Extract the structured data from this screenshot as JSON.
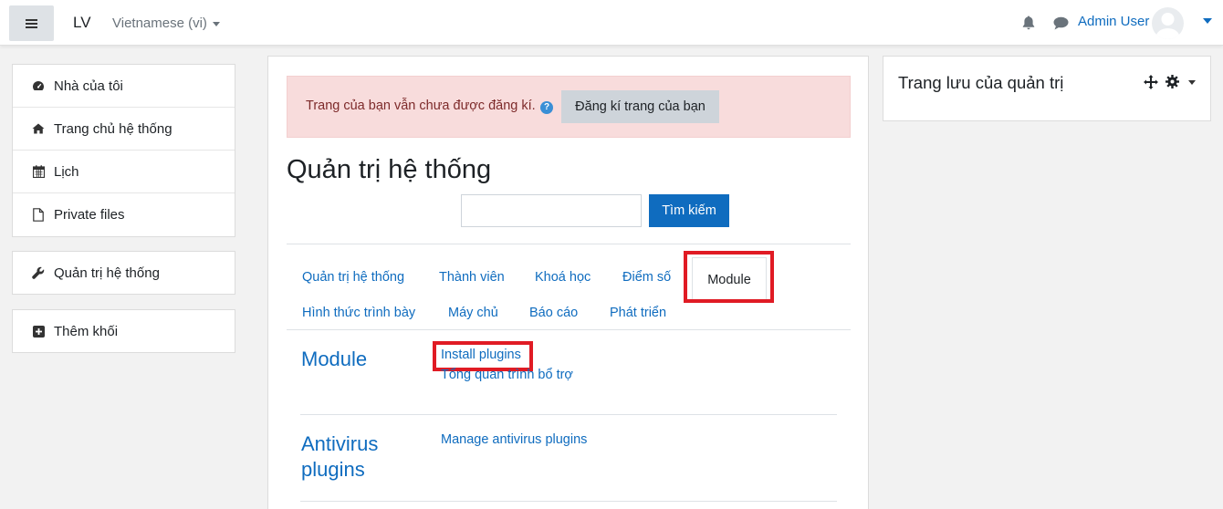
{
  "navbar": {
    "site_name": "LV",
    "language": "Vietnamese (vi)",
    "user_name": "Admin User"
  },
  "leftnav": {
    "items": [
      {
        "label": "Nhà của tôi",
        "icon": "dashboard-icon"
      },
      {
        "label": "Trang chủ hệ thống",
        "icon": "home-icon"
      },
      {
        "label": "Lịch",
        "icon": "calendar-icon"
      },
      {
        "label": "Private files",
        "icon": "file-icon"
      }
    ],
    "admin_label": "Quản trị hệ thống",
    "add_block_label": "Thêm khối"
  },
  "alert": {
    "text": "Trang của bạn vẫn chưa được đăng kí.",
    "help": "?",
    "button_label": "Đăng kí trang của bạn"
  },
  "main": {
    "title": "Quản trị hệ thống",
    "search_button": "Tìm kiếm",
    "search_value": "",
    "tabs_row1": [
      "Quản trị hệ thống",
      "Thành viên",
      "Khoá học",
      "Điểm số",
      "Module"
    ],
    "tabs_row2": [
      "Hình thức trình bày",
      "Máy chủ",
      "Báo cáo",
      "Phát triển"
    ],
    "active_tab": "Module",
    "sections": [
      {
        "title": "Module",
        "links": [
          "Install plugins",
          "Tổng quan trình bổ trợ"
        ]
      },
      {
        "title_lines": [
          "Antivirus",
          "plugins"
        ],
        "links": [
          "Manage antivirus plugins"
        ]
      }
    ]
  },
  "right_block": {
    "title": "Trang lưu của quản trị"
  },
  "colors": {
    "accent": "#0f6cbf",
    "highlight": "#e01b24",
    "alert_bg": "#f8dcdc"
  }
}
